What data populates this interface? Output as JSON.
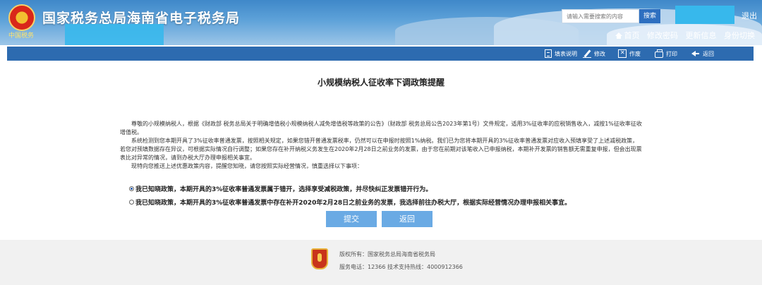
{
  "header": {
    "emblem_text": "中国税务",
    "site_title": "国家税务总局海南省电子税务局",
    "search_placeholder": "请输入需要搜索的内容",
    "search_button": "搜索",
    "logout": "退出",
    "nav": [
      "首页",
      "修改密码",
      "更新信息",
      "身份切换"
    ],
    "brand_blue": "#2d6bb0"
  },
  "toolbar": {
    "items": [
      {
        "label": "填表说明",
        "icon": "document-icon"
      },
      {
        "label": "修改",
        "icon": "pen-icon"
      },
      {
        "label": "作废",
        "icon": "void-icon"
      },
      {
        "label": "打印",
        "icon": "printer-icon"
      },
      {
        "label": "返回",
        "icon": "back-arrow-icon"
      }
    ]
  },
  "main": {
    "title": "小规模纳税人征收率下调政策提醒",
    "paragraphs": [
      "尊敬的小规模纳税人，根据《财政部 税务总局关于明确增值税小规模纳税人减免增值税等政策的公告》（财政部 税务总局公告2023年第1号）文件规定，适用3%征收率的应税销售收入，减按1%征收率征收增值税。",
      "系统检测到您本期开具了3%征收率普通发票，按照相关规定，如果您错开普通发票税率，仍然可以在申报时按照1%纳税。我们已为您将本期开具的3%征收率普通发票对应收入预填享受了上述减税政策，若您对预填数据存在异议，可根据实际情况自行调整；如果您存在补开纳税义务发生在2020年2月28日之前业务的发票，由于您在前期对该笔收入已申报纳税，本期补开发票的销售额无需重复申报，但会出现票表比对异常的情况，请到办税大厅办理申报相关事宜。",
      "现特向您推送上述优惠政策内容，提醒您知晓，请您按照实际经营情况，慎重选择以下事项："
    ],
    "options": [
      {
        "label": "我已知晓政策，本期开具的3%征收率普通发票属于错开，选择享受减税政策，并尽快纠正发票错开行为。",
        "checked": true
      },
      {
        "label": "我已知晓政策，本期开具的3%征收率普通发票中存在补开2020年2月28日之前业务的发票，我选择前往办税大厅，根据实际经营情况办理申报相关事宜。",
        "checked": false
      }
    ],
    "submit_button": "提交",
    "back_button": "返回"
  },
  "footer": {
    "copyright": "版权所有：国家税务总局海南省税务局",
    "service": "服务电话：12366 技术支持热线：4000912366"
  }
}
